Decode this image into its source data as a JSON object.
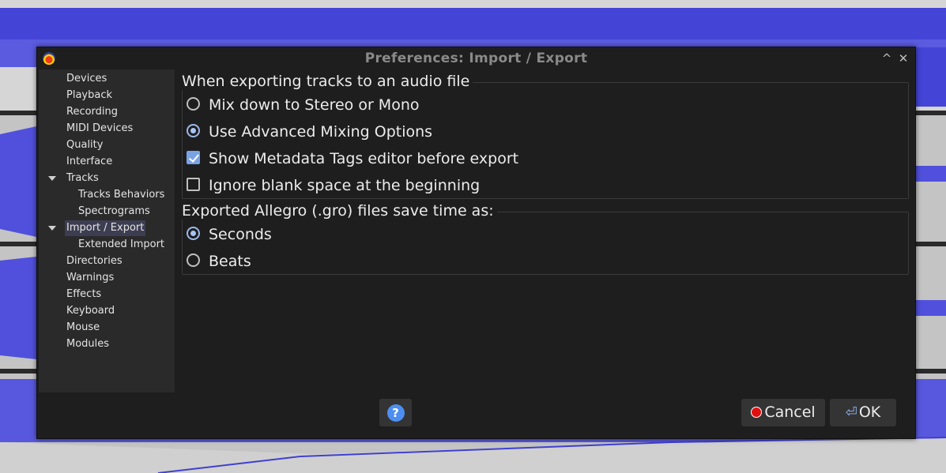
{
  "window": {
    "title": "Preferences: Import / Export",
    "minimize_glyph": "^",
    "close_glyph": "✕"
  },
  "sidebar": {
    "items": [
      {
        "label": "Devices"
      },
      {
        "label": "Playback"
      },
      {
        "label": "Recording"
      },
      {
        "label": "MIDI Devices"
      },
      {
        "label": "Quality"
      },
      {
        "label": "Interface"
      },
      {
        "label": "Tracks"
      },
      {
        "label": "Tracks Behaviors"
      },
      {
        "label": "Spectrograms"
      },
      {
        "label": "Import / Export"
      },
      {
        "label": "Extended Import"
      },
      {
        "label": "Directories"
      },
      {
        "label": "Warnings"
      },
      {
        "label": "Effects"
      },
      {
        "label": "Keyboard"
      },
      {
        "label": "Mouse"
      },
      {
        "label": "Modules"
      }
    ],
    "selected": "Import / Export"
  },
  "export_group": {
    "title": "When exporting tracks to an audio file",
    "options": [
      {
        "label": "Mix down to Stereo or Mono",
        "type": "radio",
        "checked": false
      },
      {
        "label": "Use Advanced Mixing Options",
        "type": "radio",
        "checked": true
      },
      {
        "label": "Show Metadata Tags editor before export",
        "type": "checkbox",
        "checked": true
      },
      {
        "label": "Ignore blank space at the beginning",
        "type": "checkbox",
        "checked": false
      }
    ]
  },
  "allegro_group": {
    "title": "Exported Allegro (.gro) files save time as:",
    "options": [
      {
        "label": "Seconds",
        "type": "radio",
        "checked": true
      },
      {
        "label": "Beats",
        "type": "radio",
        "checked": false
      }
    ]
  },
  "buttons": {
    "help_glyph": "?",
    "cancel_label": "Cancel",
    "ok_label": "OK",
    "ok_glyph": "⏎"
  },
  "colors": {
    "dialog_bg": "#1e1e1e",
    "sidebar_bg": "#2a2a2a",
    "selection_bg": "#3d3d52",
    "accent": "#7aa3e6",
    "waveform": "#4a4adb"
  }
}
